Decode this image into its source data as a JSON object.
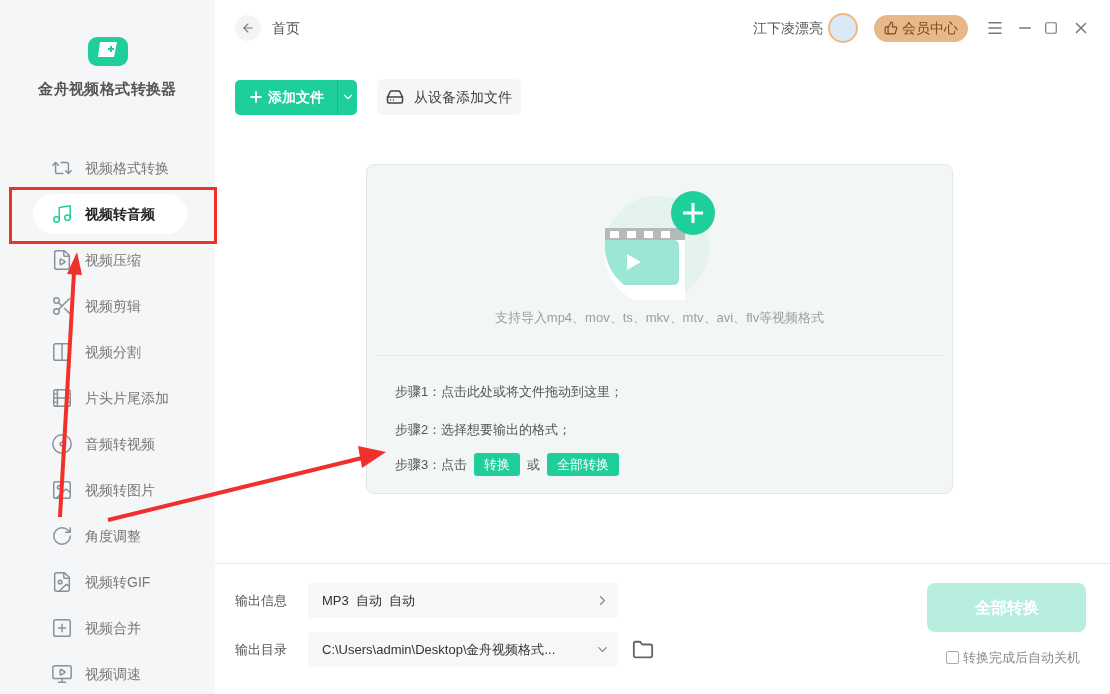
{
  "app": {
    "title": "金舟视频格式转换器"
  },
  "sidebar": {
    "items": [
      {
        "label": "视频格式转换",
        "selected": false
      },
      {
        "label": "视频转音频",
        "selected": true
      },
      {
        "label": "视频压缩",
        "selected": false
      },
      {
        "label": "视频剪辑",
        "selected": false
      },
      {
        "label": "视频分割",
        "selected": false
      },
      {
        "label": "片头片尾添加",
        "selected": false
      },
      {
        "label": "音频转视频",
        "selected": false
      },
      {
        "label": "视频转图片",
        "selected": false
      },
      {
        "label": "角度调整",
        "selected": false
      },
      {
        "label": "视频转GIF",
        "selected": false
      },
      {
        "label": "视频合并",
        "selected": false
      },
      {
        "label": "视频调速",
        "selected": false
      }
    ]
  },
  "header": {
    "breadcrumb": "首页",
    "username": "江下凌漂亮",
    "vip_button": "会员中心"
  },
  "toolbar": {
    "add_file": "添加文件",
    "add_from_device": "从设备添加文件"
  },
  "dropzone": {
    "formats": "支持导入mp4、mov、ts、mkv、mtv、avi、flv等视频格式",
    "step1": "步骤1：点击此处或将文件拖动到这里；",
    "step2": "步骤2：选择想要输出的格式；",
    "step3_prefix": "步骤3：点击",
    "step3_button": "转换",
    "step3_or": "或",
    "step3_button_all": "全部转换"
  },
  "output": {
    "info_label": "输出信息",
    "info_value": "MP3  自动  自动",
    "dir_label": "输出目录",
    "dir_value": "C:\\Users\\admin\\Desktop\\金舟视频格式..."
  },
  "convert_all": {
    "label": "全部转换",
    "disabled": true
  },
  "auto_shutdown": {
    "label": "转换完成后自动关机",
    "checked": false
  }
}
